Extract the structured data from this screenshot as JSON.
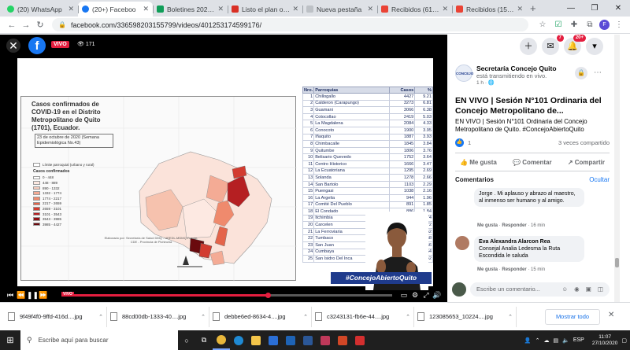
{
  "browser": {
    "tabs": [
      {
        "title": "(20) WhatsApp",
        "color": "#25d366",
        "active": false
      },
      {
        "title": "(20+) Faceboo",
        "color": "#1877f2",
        "active": true
      },
      {
        "title": "Boletines 2020 - p",
        "color": "#0f9d58",
        "active": false
      },
      {
        "title": "Listo el plan oper",
        "color": "#d93025",
        "active": false
      },
      {
        "title": "Nueva pestaña",
        "color": "#e8eaed",
        "active": false
      },
      {
        "title": "Recibidos (61) - ic",
        "color": "#ea4335",
        "active": false
      },
      {
        "title": "Recibidos (156) - i",
        "color": "#ea4335",
        "active": false
      }
    ],
    "url": "facebook.com/336598203155799/videos/401253174599176/"
  },
  "video": {
    "live_label": "VIVO",
    "viewers": "171",
    "hashtag": "#ConcejoAbiertoQuito",
    "progress": 0.62,
    "slide": {
      "title": "Casos confirmados de COVID-19 en el Distrito Metropolitano de Quito (1701), Ecuador.",
      "date": "23 de octubre de 2020 (Semana Epidemiológica No.43)",
      "legend_title1": "Límite parroquial (urbano y rural)",
      "legend_title2": "Casos confirmados",
      "legend": [
        {
          "label": "0 - 448",
          "color": "#ffffff"
        },
        {
          "label": "448 - 889",
          "color": "#fde9e2"
        },
        {
          "label": "890 - 1332",
          "color": "#f9cdbd"
        },
        {
          "label": "1332 - 1774",
          "color": "#f4ab95"
        },
        {
          "label": "1774 - 2217",
          "color": "#ef8a6d"
        },
        {
          "label": "2217 - 2659",
          "color": "#e4644a"
        },
        {
          "label": "2659 - 3101",
          "color": "#d23c30"
        },
        {
          "label": "3101 - 3543",
          "color": "#b51f22"
        },
        {
          "label": "3543 - 3985",
          "color": "#8f1016"
        },
        {
          "label": "3985 - 4427",
          "color": "#6a0a0e"
        }
      ],
      "footer": "Elaborado por: Secretaría de Salud DMQ - UEEDL-MDMQ  Fuente: CDE - Provincia de Pichincha",
      "table": {
        "headers": [
          "Nro.",
          "Parroquias",
          "Casos",
          "%"
        ],
        "rows": [
          [
            "1",
            "Chillogallo",
            "4427",
            "9.21"
          ],
          [
            "2",
            "Calderon (Carapungo)",
            "3273",
            "6.81"
          ],
          [
            "3",
            "Guamani",
            "3066",
            "6.38"
          ],
          [
            "4",
            "Cotocollao",
            "2419",
            "5.03"
          ],
          [
            "5",
            "La Magdalena",
            "2084",
            "4.33"
          ],
          [
            "6",
            "Conocoto",
            "1900",
            "3.95"
          ],
          [
            "7",
            "Iñaquito",
            "1887",
            "3.93"
          ],
          [
            "8",
            "Chimbacalle",
            "1845",
            "3.84"
          ],
          [
            "9",
            "Quitumbe",
            "1806",
            "3.76"
          ],
          [
            "10",
            "Belisario Quevedo",
            "1752",
            "3.64"
          ],
          [
            "11",
            "Centro Historico",
            "1666",
            "3.47"
          ],
          [
            "12",
            "La Ecuatoriana",
            "1295",
            "2.69"
          ],
          [
            "13",
            "Solanda",
            "1278",
            "2.66"
          ],
          [
            "14",
            "San Bartolo",
            "1103",
            "2.29"
          ],
          [
            "15",
            "Puengasi",
            "1038",
            "2.16"
          ],
          [
            "16",
            "La Argelia",
            "944",
            "1.96"
          ],
          [
            "17",
            "Comité Del Pueblo",
            "891",
            "1.85"
          ],
          [
            "18",
            "El Condado",
            "886",
            "1.84"
          ],
          [
            "19",
            "Itchimbia",
            "837",
            "1.74"
          ],
          [
            "20",
            "Carcelen",
            "",
            "1.72"
          ],
          [
            "21",
            "La Ferroviaria",
            "",
            "1.62"
          ],
          [
            "22",
            "Tumbaco",
            "",
            "1.58"
          ],
          [
            "23",
            "San Juan",
            "",
            "1.56"
          ],
          [
            "24",
            "Cumbaya",
            "",
            "1.54"
          ],
          [
            "25",
            "San Isidro Del Inca",
            "",
            "1.42"
          ]
        ]
      }
    }
  },
  "sidebar": {
    "messenger_badge": "7",
    "notif_badge": "20+",
    "page_name": "Secretaría Concejo Quito",
    "page_sub": "está transmitiendo en vivo.",
    "time": "1 h ·",
    "avatar_text": "CONCEJO",
    "post_title": "EN VIVO | Sesión N°101 Ordinaria del Concejo Metropolitano de...",
    "post_desc": "EN VIVO | Sesión N°101 Ordinaria del Concejo Metropolitano de Quito.",
    "post_tag": "#ConcejoAbiertoQuito",
    "likes": "1",
    "shares": "3 veces compartido",
    "like_btn": "Me gusta",
    "comment_btn": "Comentar",
    "share_btn": "Compartir",
    "comments_label": "Comentarios",
    "hide_label": "Ocultar",
    "comment1_text": "Jorge . Mi aplauso y abrazo al maestro, al inmenso ser humano y al amigo.",
    "comment1_like": "Me gusta",
    "comment1_reply": "Responder",
    "comment1_time": "16 min",
    "comment2_author": "Eva Alexandra Alarcon Rea",
    "comment2_text": "Consejal Analia Ledesma la Ruta Escondida le saluda",
    "comment2_like": "Me gusta",
    "comment2_reply": "Responder",
    "comment2_time": "15 min",
    "composer_placeholder": "Escribe un comentario..."
  },
  "downloads": {
    "items": [
      "9f49f4f0-9ffd-416d....jpg",
      "88cd00db-1333-40....jpg",
      "debbe6ed-8634-4....jpg",
      "c3243131-fb6e-44....jpg",
      "123085653_10224....jpg"
    ],
    "show_all": "Mostrar todo"
  },
  "taskbar": {
    "search_placeholder": "Escribe aquí para buscar",
    "lang": "ESP",
    "time": "11:07",
    "date": "27/10/2020"
  }
}
